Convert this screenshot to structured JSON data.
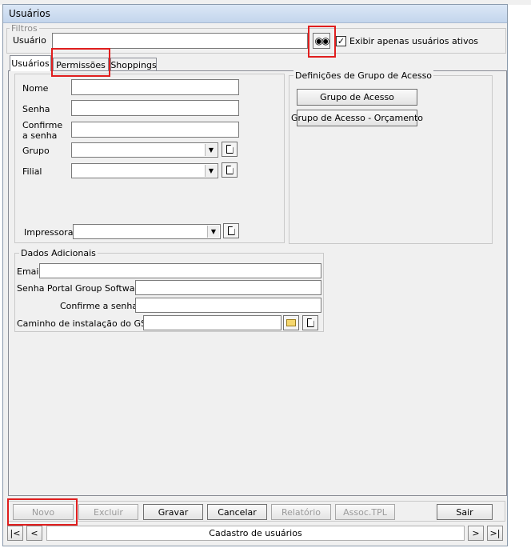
{
  "window": {
    "title": "Usuários"
  },
  "filters": {
    "legend": "Filtros",
    "user_label": "Usuário",
    "user_value": "",
    "search_icon": "binoculars-icon",
    "active_only_label": "Exibir apenas usuários ativos",
    "active_only_checked": true
  },
  "tabs": [
    {
      "label": "Usuários"
    },
    {
      "label": "Permissões"
    },
    {
      "label": "Shoppings"
    }
  ],
  "form": {
    "name_label": "Nome",
    "password_label": "Senha",
    "confirm_label_line1": "Confirme",
    "confirm_label_line2": "a senha",
    "group_label": "Grupo",
    "branch_label": "Filial",
    "printer_label": "Impressora"
  },
  "access_group": {
    "legend": "Definições de Grupo de Acesso",
    "access_group_button": "Grupo de Acesso",
    "budget_access_group_button": "Grupo de Acesso - Orçamento"
  },
  "extra": {
    "legend": "Dados Adicionais",
    "email_label": "Email",
    "portal_password_label": "Senha Portal Group Software",
    "confirm_password_label": "Confirme a senha",
    "install_path_label": "Caminho de instalação do GShop"
  },
  "toolbar": {
    "new": "Novo",
    "delete": "Excluir",
    "save": "Gravar",
    "cancel": "Cancelar",
    "report": "Relatório",
    "assoc": "Assoc.TPL",
    "exit": "Sair"
  },
  "status": {
    "first": "|<",
    "prev": "<",
    "text": "Cadastro de usuários",
    "next": ">",
    "last": ">|"
  },
  "colors": {
    "highlight": "#e01e1e",
    "window_bg": "#f0f0f0",
    "titlebar": "#c3d5ec"
  }
}
